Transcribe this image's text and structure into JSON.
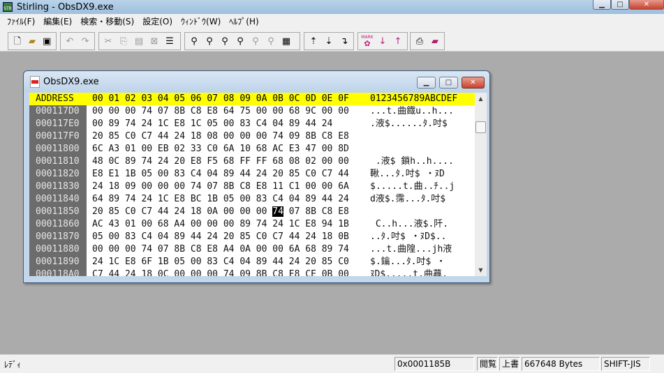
{
  "window": {
    "title": "Stirling - ObsDX9.exe",
    "icon_label": "STR",
    "controls": [
      "minimize-icon",
      "maximize-icon",
      "close-icon"
    ]
  },
  "menu": [
    "ﾌｧｲﾙ(F)",
    "編集(E)",
    "検索・移動(S)",
    "設定(O)",
    "ｳｨﾝﾄﾞｳ(W)",
    "ﾍﾙﾌﾟ(H)"
  ],
  "toolbar": {
    "icons": [
      "new-file-icon",
      "open-folder-icon",
      "save-icon",
      "undo-icon",
      "redo-icon",
      "cut-icon",
      "copy-icon",
      "paste-icon",
      "clear-icon",
      "insert-mode-icon",
      "find-icon",
      "find-next-icon",
      "find-prev-icon",
      "replace-icon",
      "compare-icon",
      "compare-next-icon",
      "goto-top-icon",
      "goto-bottom-icon",
      "goto-end-icon",
      "mark-icon",
      "mark-next-icon",
      "mark-prev-icon",
      "print-icon",
      "book-icon"
    ],
    "mark_label": "MARK"
  },
  "child": {
    "title": "ObsDX9.exe",
    "header": {
      "address": "ADDRESS",
      "hex": "00 01 02 03 04 05 06 07 08 09 0A 0B 0C 0D 0E 0F",
      "text": "0123456789ABCDEF"
    },
    "rows": [
      {
        "addr": "000117D0",
        "hex": "00 00 00 74 07 8B C8 E8 64 75 00 00 68 9C 00 00",
        "text": "...t.曲鐡u..h..."
      },
      {
        "addr": "000117E0",
        "hex": "00 89 74 24 1C E8 1C 05 00 83 C4 04 89 44 24",
        "text": ".液$......ﾀ.吋$"
      },
      {
        "addr": "000117F0",
        "hex": "20 85 C0 C7 44 24 18 08 00 00 00 74 09 8B C8 E8",
        "text": ""
      },
      {
        "addr": "00011800",
        "hex": "6C A3 01 00 EB 02 33 C0 6A 10 68 AC E3 47 00 8D",
        "text": ""
      },
      {
        "addr": "00011810",
        "hex": "48 0C 89 74 24 20 E8 F5 68 FF FF 68 08 02 00 00",
        "text": " .液$ 鎖h..h...."
      },
      {
        "addr": "00011820",
        "hex": "E8 E1 1B 05 00 83 C4 04 89 44 24 20 85 C0 C7 44",
        "text": "鞦...ﾀ.吋$ ・ﾇD"
      },
      {
        "addr": "00011830",
        "hex": "24 18 09 00 00 00 74 07 8B C8 E8 11 C1 00 00 6A",
        "text": "$.....t.曲..ﾁ..j"
      },
      {
        "addr": "00011840",
        "hex": "64 89 74 24 1C E8 BC 1B 05 00 83 C4 04 89 44 24",
        "text": "d液$.霈...ﾀ.吋$"
      },
      {
        "addr": "00011850",
        "hex": "20 85 C0 C7 44 24 18 0A 00 00 00 ",
        "cursor": "74",
        "hex_rest": " 07 8B C8 E8",
        "text": ""
      },
      {
        "addr": "00011860",
        "hex": "AC 43 01 00 68 A4 00 00 00 89 74 24 1C E8 94 1B",
        "text": " C..h...液$.阡."
      },
      {
        "addr": "00011870",
        "hex": "05 00 83 C4 04 89 44 24 20 85 C0 C7 44 24 18 0B",
        "text": "..ﾀ.吋$ ・ﾇD$.."
      },
      {
        "addr": "00011880",
        "hex": "00 00 00 74 07 8B C8 E8 A4 0A 00 00 6A 68 89 74",
        "text": "...t.曲隍...jh液"
      },
      {
        "addr": "00011890",
        "hex": "24 1C E8 6F 1B 05 00 83 C4 04 89 44 24 20 85 C0",
        "text": "$.鑰...ﾀ.吋$ ・"
      },
      {
        "addr": "000118A0",
        "hex": "C7 44 24 18 0C 00 00 00 74 09 8B C8 E8 CE 0B 00",
        "text": "ﾇD$.....t.曲蕁."
      }
    ]
  },
  "status": {
    "mode": "ﾚﾃﾞｨ",
    "offset": "0x0001185B",
    "view": "閲覧",
    "write": "上書",
    "size": "667648 Bytes",
    "encoding": "SHIFT-JIS"
  }
}
